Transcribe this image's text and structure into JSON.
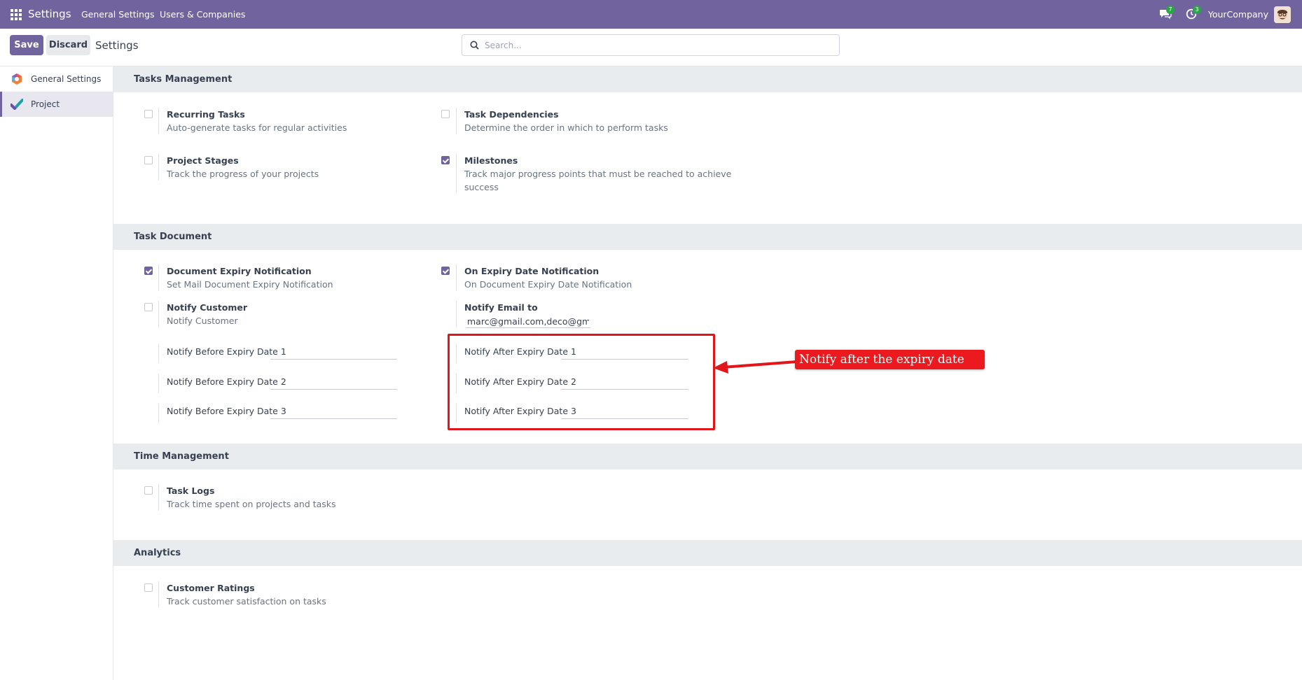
{
  "navbar": {
    "brand": "Settings",
    "links": [
      "General Settings",
      "Users & Companies"
    ],
    "messages_count": "7",
    "activities_count": "3",
    "company": "YourCompany"
  },
  "control_panel": {
    "save_label": "Save",
    "discard_label": "Discard",
    "title": "Settings",
    "search_placeholder": "Search..."
  },
  "sidebar": {
    "items": [
      {
        "label": "General Settings",
        "icon": "odoo-logo-icon"
      },
      {
        "label": "Project",
        "icon": "project-icon",
        "active": true
      }
    ]
  },
  "sections": {
    "tasks_management": {
      "title": "Tasks Management",
      "recurring_tasks": {
        "title": "Recurring Tasks",
        "desc": "Auto-generate tasks for regular activities",
        "checked": false
      },
      "task_dependencies": {
        "title": "Task Dependencies",
        "desc": "Determine the order in which to perform tasks",
        "checked": false
      },
      "project_stages": {
        "title": "Project Stages",
        "desc": "Track the progress of your projects",
        "checked": false
      },
      "milestones": {
        "title": "Milestones",
        "desc_line1": "Track major progress points that must be reached to achieve",
        "desc_line2": "success",
        "checked": true
      }
    },
    "task_document": {
      "title": "Task Document",
      "doc_expiry": {
        "title": "Document Expiry Notification",
        "desc": "Set Mail Document Expiry Notification",
        "checked": true
      },
      "on_expiry": {
        "title": "On Expiry Date Notification",
        "desc": "On Document Expiry Date Notification",
        "checked": true
      },
      "notify_customer": {
        "title": "Notify Customer",
        "desc": "Notify Customer",
        "checked": false
      },
      "notify_email": {
        "title": "Notify Email to",
        "value": "marc@gmail.com,deco@gmail."
      },
      "before_1": {
        "label": "Notify Before Expiry Date 1",
        "value": ""
      },
      "before_2": {
        "label": "Notify Before Expiry Date 2",
        "value": ""
      },
      "before_3": {
        "label": "Notify Before Expiry Date 3",
        "value": ""
      },
      "after_1": {
        "label": "Notify After Expiry Date 1",
        "value": ""
      },
      "after_2": {
        "label": "Notify After Expiry Date 2",
        "value": ""
      },
      "after_3": {
        "label": "Notify After Expiry Date 3",
        "value": ""
      }
    },
    "time_management": {
      "title": "Time Management",
      "task_logs": {
        "title": "Task Logs",
        "desc": "Track time spent on projects and tasks",
        "checked": false
      }
    },
    "analytics": {
      "title": "Analytics",
      "customer_ratings": {
        "title": "Customer Ratings",
        "desc": "Track customer satisfaction on tasks",
        "checked": false
      }
    }
  },
  "annotation": {
    "callout_text": "Notify after the expiry date",
    "color": "#e0161b"
  },
  "colors": {
    "brand": "#71639e",
    "section_bg": "#e9ecef"
  }
}
